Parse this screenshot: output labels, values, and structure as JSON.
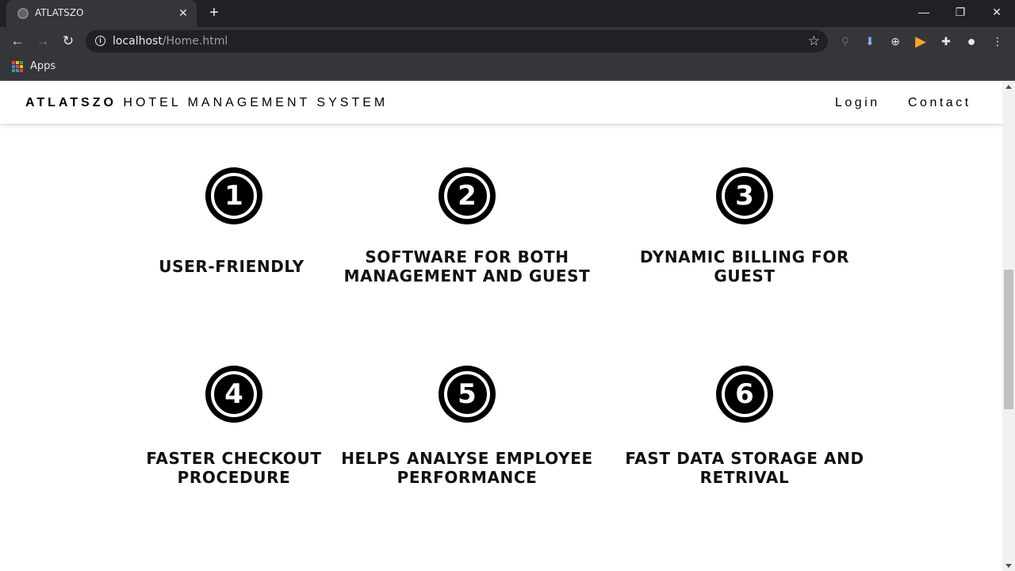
{
  "browser": {
    "tab_title": "ATLATSZO",
    "tab_close": "✕",
    "new_tab": "+",
    "url_host": "localhost",
    "url_path": "/Home.html",
    "bookmarks_apps_label": "Apps",
    "window_buttons": {
      "minimize": "—",
      "restore": "❐",
      "close": "✕"
    }
  },
  "site": {
    "brand_bold": "ATLATSZO",
    "brand_rest": "HOTEL MANAGEMENT SYSTEM",
    "nav": {
      "login": "Login",
      "contact": "Contact"
    }
  },
  "features": [
    {
      "number": "1",
      "title": "USER-FRIENDLY"
    },
    {
      "number": "2",
      "title": "SOFTWARE FOR BOTH\nMANAGEMENT AND GUEST"
    },
    {
      "number": "3",
      "title": "DYNAMIC BILLING FOR\nGUEST"
    },
    {
      "number": "4",
      "title": "FASTER CHECKOUT\nPROCEDURE"
    },
    {
      "number": "5",
      "title": "HELPS ANALYSE EMPLOYEE\nPERFORMANCE"
    },
    {
      "number": "6",
      "title": "FAST DATA STORAGE AND\nRETRIVAL"
    }
  ],
  "colors": {
    "chrome_dark": "#202124",
    "chrome_toolbar": "#35363a",
    "download_ext": "#8ab4f8",
    "play_ext": "#f5a623"
  }
}
